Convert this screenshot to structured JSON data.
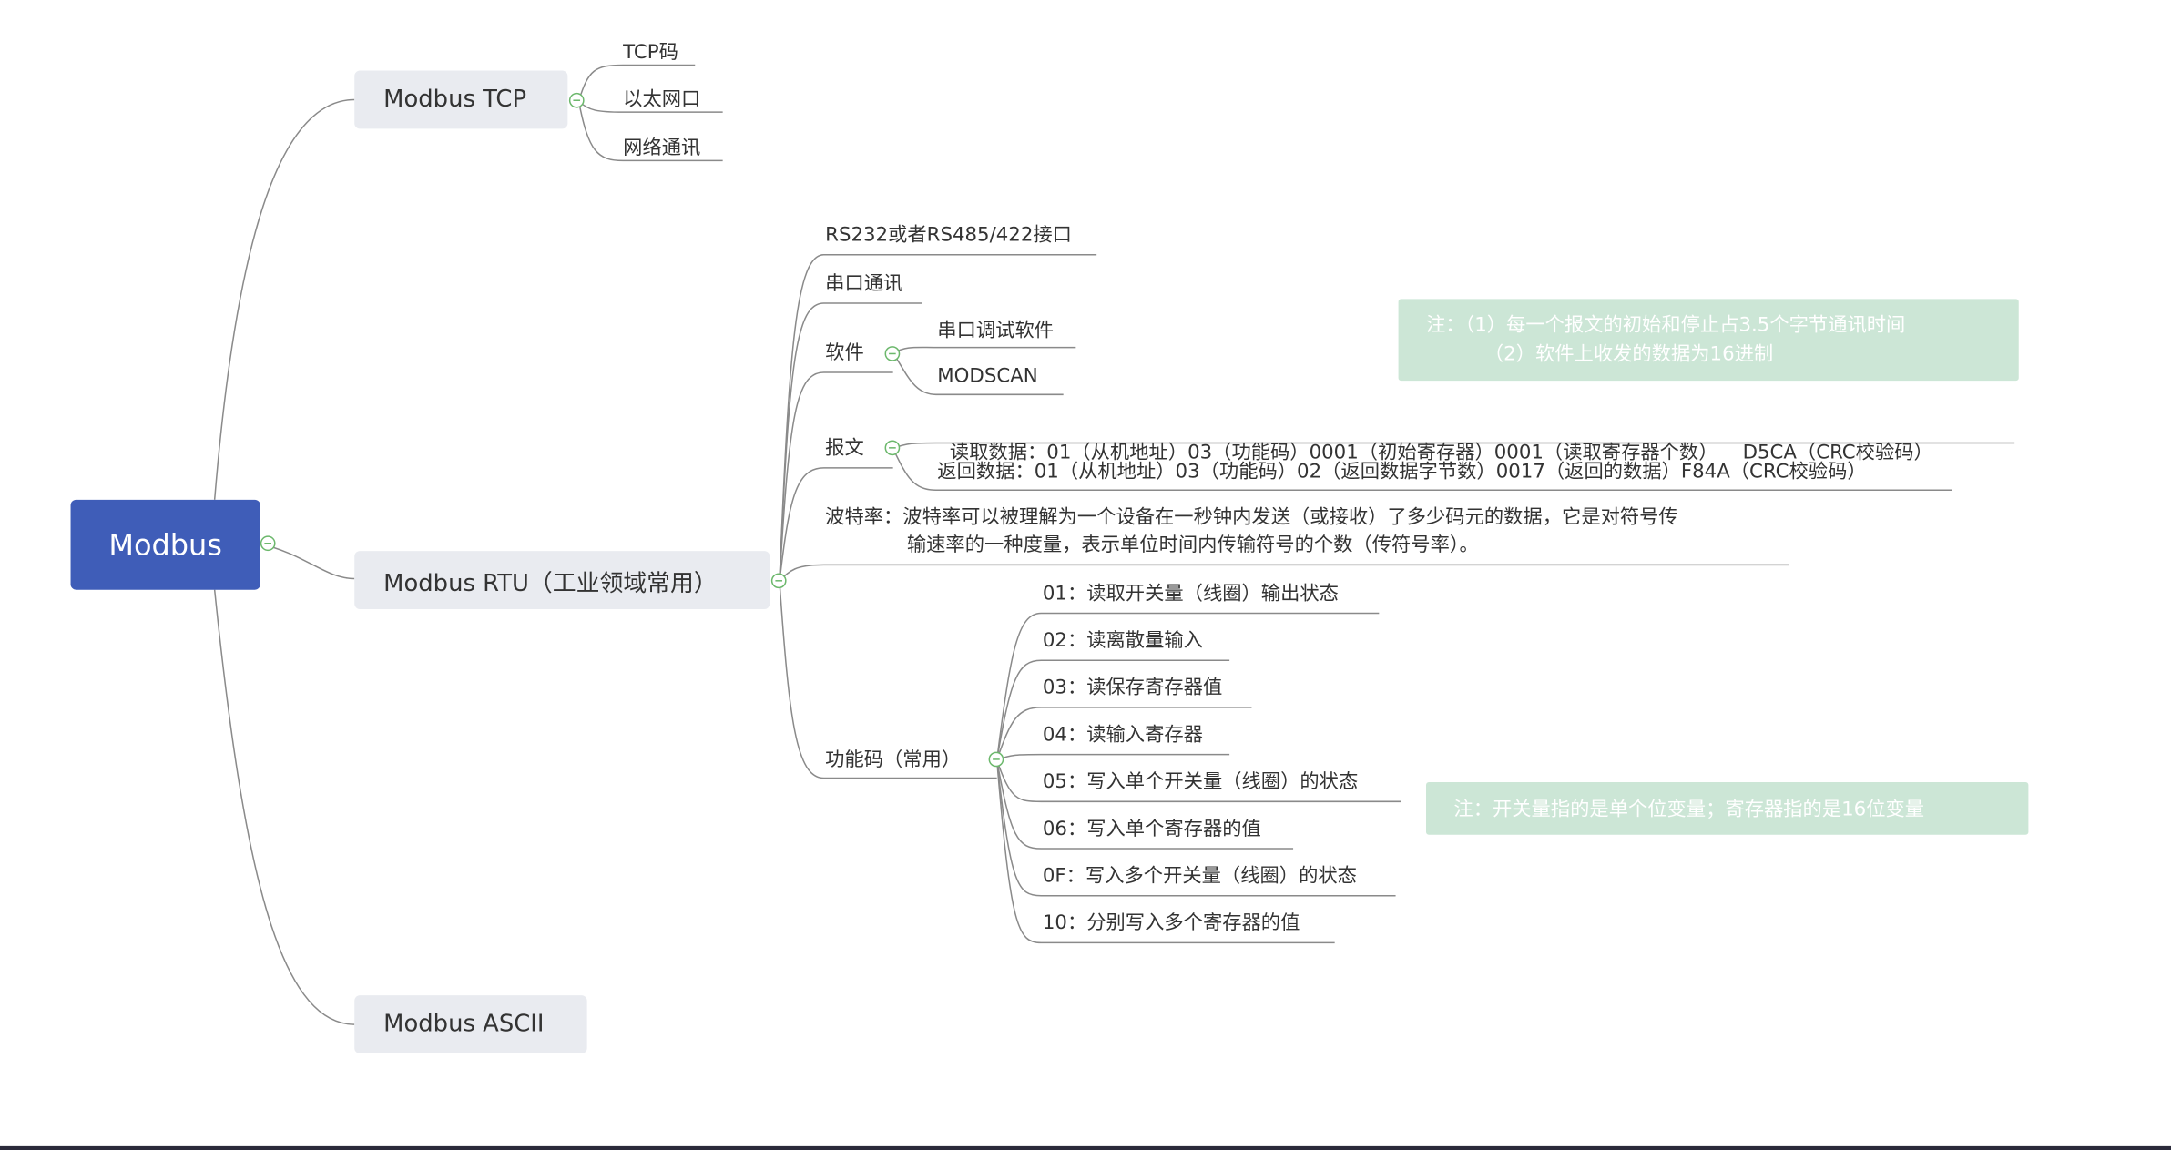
{
  "root": {
    "label": "Modbus"
  },
  "branches": {
    "tcp": {
      "label": "Modbus TCP",
      "children": [
        "TCP码",
        "以太网口",
        "网络通讯"
      ]
    },
    "rtu": {
      "label": "Modbus RTU（工业领域常用）",
      "interface": "RS232或者RS485/422接口",
      "serial": "串口通讯",
      "software": {
        "label": "软件",
        "children": [
          "串口调试软件",
          "MODSCAN"
        ]
      },
      "message": {
        "label": "报文",
        "read": "读取数据：01（从机地址）03（功能码）0001（初始寄存器）0001（读取寄存器个数）    D5CA（CRC校验码）",
        "return": "返回数据：01（从机地址）03（功能码）02（返回数据字节数）0017（返回的数据）F84A（CRC校验码）"
      },
      "baud": {
        "line1": "波特率：波特率可以被理解为一个设备在一秒钟内发送（或接收）了多少码元的数据，它是对符号传",
        "line2": "输速率的一种度量，表示单位时间内传输符号的个数（传符号率）。"
      },
      "function_codes": {
        "label": "功能码（常用）",
        "items": [
          "01：读取开关量（线圈）输出状态",
          "02：读离散量输入",
          "03：读保存寄存器值",
          "04：读输入寄存器",
          "05：写入单个开关量（线圈）的状态",
          "06：写入单个寄存器的值",
          "0F：写入多个开关量（线圈）的状态",
          "10：分别写入多个寄存器的值"
        ]
      }
    },
    "ascii": {
      "label": "Modbus ASCII"
    }
  },
  "notes": {
    "message_note": {
      "line1": "注：（1）每一个报文的初始和停止占3.5个字节通讯时间",
      "line2": "（2）软件上收发的数据为16进制"
    },
    "function_note": "注：开关量指的是单个位变量；寄存器指的是16位变量"
  },
  "colors": {
    "root": "#3f5db8",
    "main_topic": "#e9ebf0",
    "note": "#cce6d6",
    "collapse": "#6cb86c",
    "line": "#8a8a8a"
  }
}
